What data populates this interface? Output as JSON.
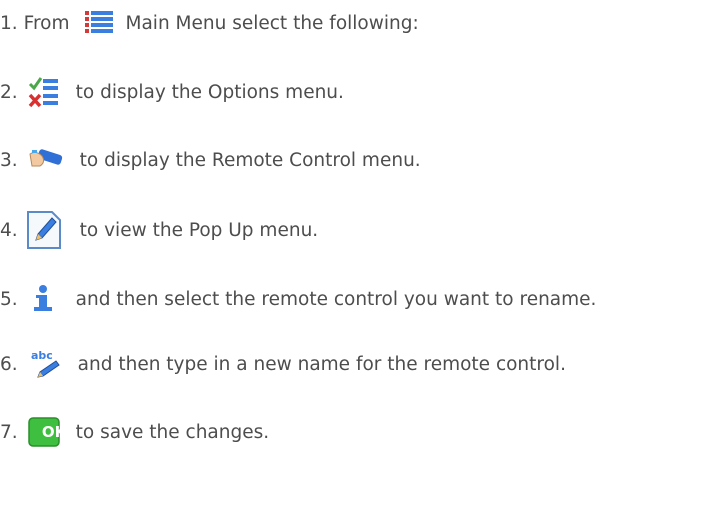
{
  "steps": [
    {
      "num": "1.",
      "pre": "From",
      "icon": "main-menu-icon",
      "text": "Main Menu select the following:"
    },
    {
      "num": "2.",
      "icon": "options-icon",
      "text": "to display the Options menu."
    },
    {
      "num": "3.",
      "icon": "remote-control-icon",
      "text": "to display the Remote Control menu."
    },
    {
      "num": "4.",
      "icon": "edit-pencil-icon",
      "text": "to view the Pop Up menu."
    },
    {
      "num": "5.",
      "icon": "info-icon",
      "text": "and then select the remote control you want to rename."
    },
    {
      "num": "6.",
      "icon": "rename-abc-icon",
      "text": "and then type in a new name for the remote control."
    },
    {
      "num": "7.",
      "icon": "ok-icon",
      "icon_label": "OK",
      "text": "to save the changes."
    }
  ],
  "colors": {
    "text": "#4d4d4d",
    "ok_green": "#3fbf3f",
    "menu_blue": "#2f6fd6"
  }
}
